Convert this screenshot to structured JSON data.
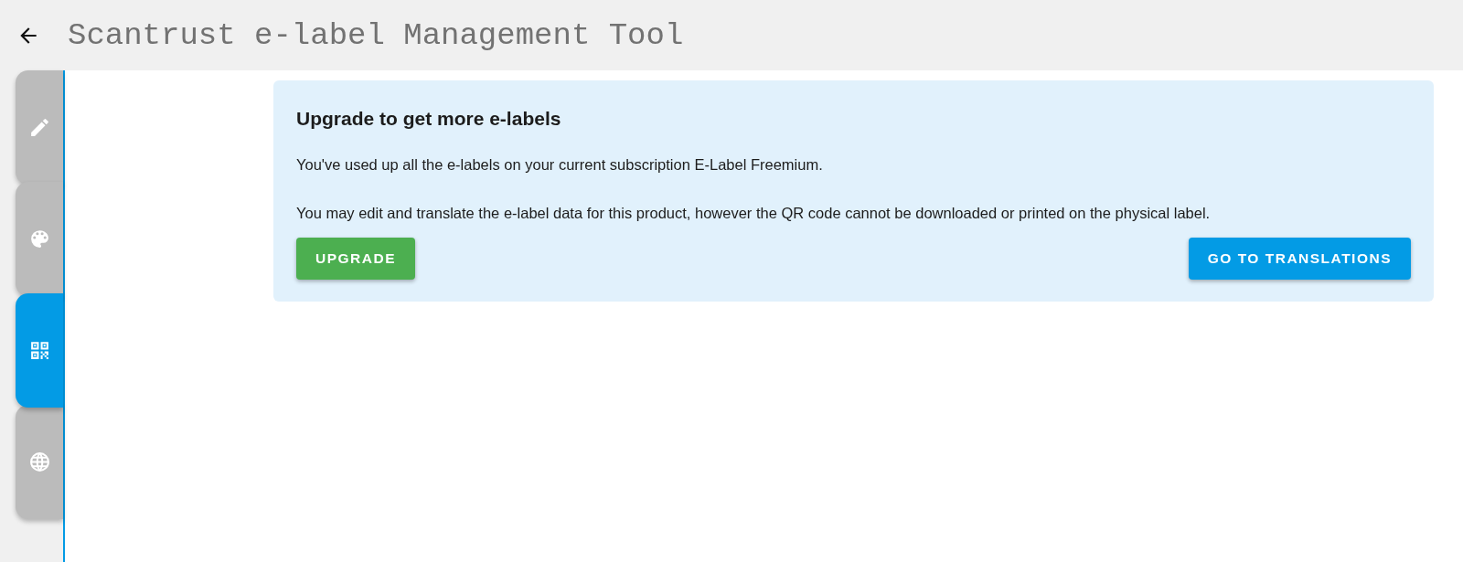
{
  "header": {
    "title": "Scantrust e-label Management Tool"
  },
  "tabs": [
    {
      "kind": "pencil",
      "selected": false
    },
    {
      "kind": "palette",
      "selected": false
    },
    {
      "kind": "qr",
      "selected": true
    },
    {
      "kind": "globe",
      "selected": false
    }
  ],
  "notice": {
    "title": "Upgrade to get more e-labels",
    "paragraphs": [
      "You've used up all the e-labels on your current subscription E-Label Freemium.",
      "You may edit and translate the e-label data for this product, however the QR code cannot be downloaded or printed on the physical label."
    ],
    "buttons": [
      {
        "kind": "upgrade",
        "label": "UPGRADE"
      },
      {
        "kind": "primary",
        "label": "GO TO TRANSLATIONS"
      }
    ]
  }
}
